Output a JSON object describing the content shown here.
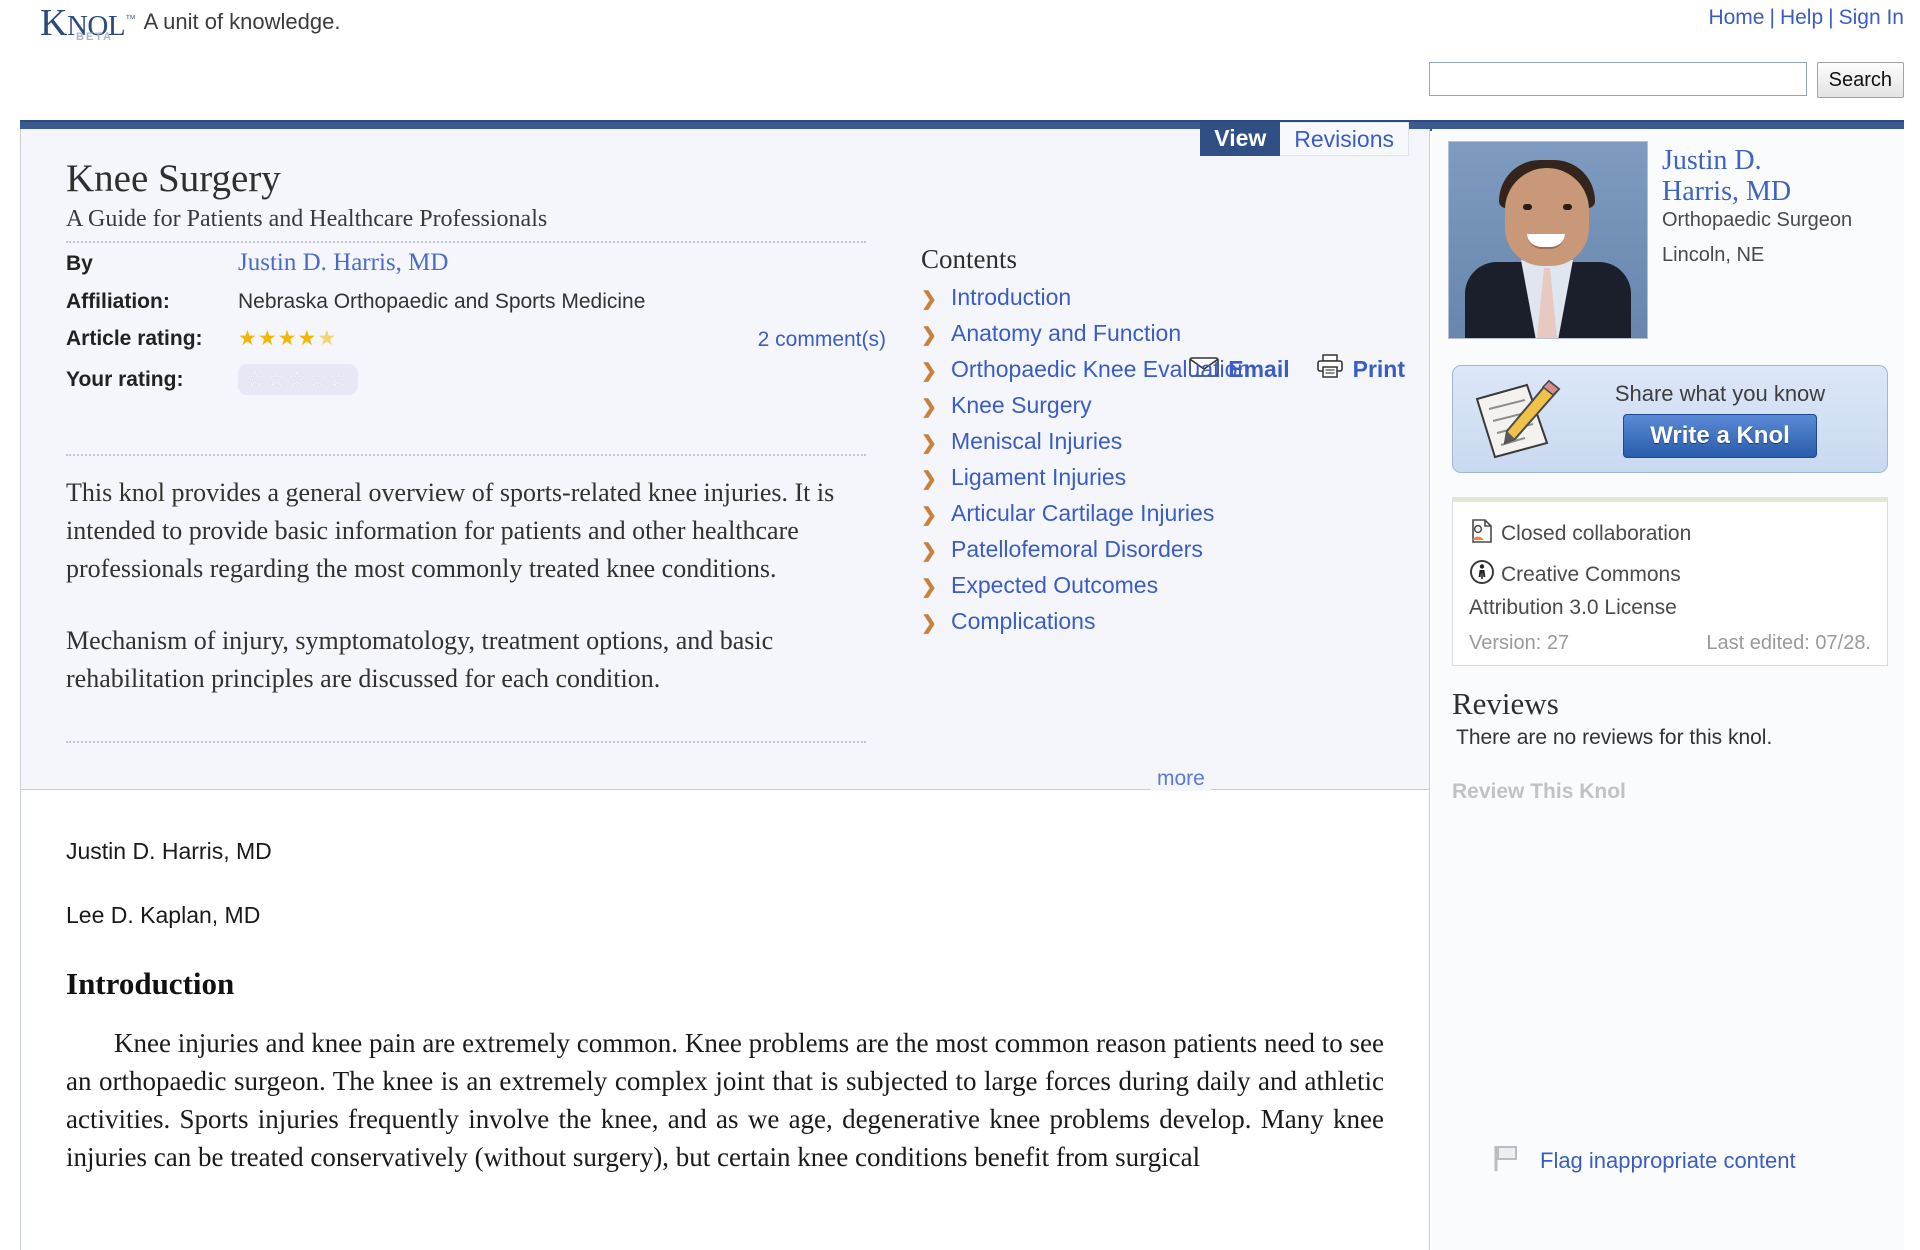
{
  "header": {
    "logo_main": "K",
    "logo_rest_1": "NOL",
    "logo_tm": "™",
    "logo_beta": "BETA",
    "tagline": "A unit of knowledge.",
    "nav": [
      {
        "label": "Home"
      },
      {
        "label": "Help"
      },
      {
        "label": "Sign In"
      }
    ],
    "nav_separator": "|",
    "search": {
      "value": "",
      "placeholder": "",
      "button_label": "Search"
    }
  },
  "article": {
    "tabs": [
      {
        "label": "View",
        "active": true
      },
      {
        "label": "Revisions",
        "active": false
      }
    ],
    "title": "Knee Surgery",
    "subtitle": "A Guide for Patients and Healthcare Professionals",
    "actions": [
      {
        "label": "Email",
        "icon": "envelope-icon"
      },
      {
        "label": "Print",
        "icon": "printer-icon"
      }
    ],
    "meta": {
      "by_label": "By",
      "by_value": "Justin D. Harris, MD",
      "affiliation_label": "Affiliation:",
      "affiliation_value": "Nebraska Orthopaedic and Sports Medicine",
      "article_rating_label": "Article rating:",
      "article_rating_value": 4.5,
      "article_rating_stars": "★★★★",
      "article_rating_half": "★",
      "your_rating_label": "Your rating:",
      "your_rating_value": 0,
      "your_rating_stars": "☆☆☆☆☆",
      "comments_link": "2 comment(s)"
    },
    "abstract": [
      "This knol provides a general overview of sports-related knee injuries. It is intended to provide basic information for patients and other healthcare professionals regarding the most commonly treated knee conditions.",
      "Mechanism of injury, symptomatology, treatment options, and basic rehabilitation principles are discussed for each condition."
    ],
    "more_label": "more",
    "contents": {
      "title": "Contents",
      "bullet": "❯",
      "items": [
        {
          "label": "Introduction"
        },
        {
          "label": "Anatomy and Function"
        },
        {
          "label": "Orthopaedic Knee Evaluation"
        },
        {
          "label": "Knee Surgery"
        },
        {
          "label": "Meniscal Injuries"
        },
        {
          "label": "Ligament Injuries"
        },
        {
          "label": "Articular Cartilage Injuries"
        },
        {
          "label": "Patellofemoral Disorders"
        },
        {
          "label": "Expected Outcomes"
        },
        {
          "label": "Complications"
        }
      ]
    },
    "body": {
      "authors": [
        "Justin D. Harris, MD",
        "Lee D. Kaplan, MD"
      ],
      "section_heading": "Introduction",
      "paragraph": "Knee injuries and knee pain are extremely common.  Knee problems are the most common reason patients need to see an orthopaedic surgeon.  The knee is an extremely complex joint that is subjected to large forces during daily and athletic activities.  Sports injuries frequently involve the knee, and as we age, degenerative knee problems develop.  Many knee injuries can be treated conservatively (without surgery), but certain knee conditions benefit from surgical"
    }
  },
  "sidebar": {
    "author": {
      "name": "Justin D. Harris, MD",
      "role": "Orthopaedic Surgeon",
      "location": "Lincoln, NE"
    },
    "write_knol": {
      "share_text": "Share what you know",
      "button_label": "Write a Knol"
    },
    "license": {
      "collaboration": "Closed collaboration",
      "license_line1": "Creative Commons",
      "license_line2": "Attribution 3.0 License",
      "version": "Version: 27",
      "last_edited": "Last edited: 07/28."
    },
    "reviews": {
      "title": "Reviews",
      "empty_text": "There are no reviews for this knol.",
      "review_link": "Review This Knol"
    },
    "flag": {
      "label": "Flag inappropriate content"
    }
  },
  "colors": {
    "brand_blue": "#2a4b7c",
    "link_blue": "#3b5cc4",
    "header_rule": "#3a5a91",
    "tab_active_bg": "#2f4f85",
    "panel_bg": "#f4f6fb",
    "star_gold": "#f2b705",
    "bullet_orange": "#c8813c"
  }
}
